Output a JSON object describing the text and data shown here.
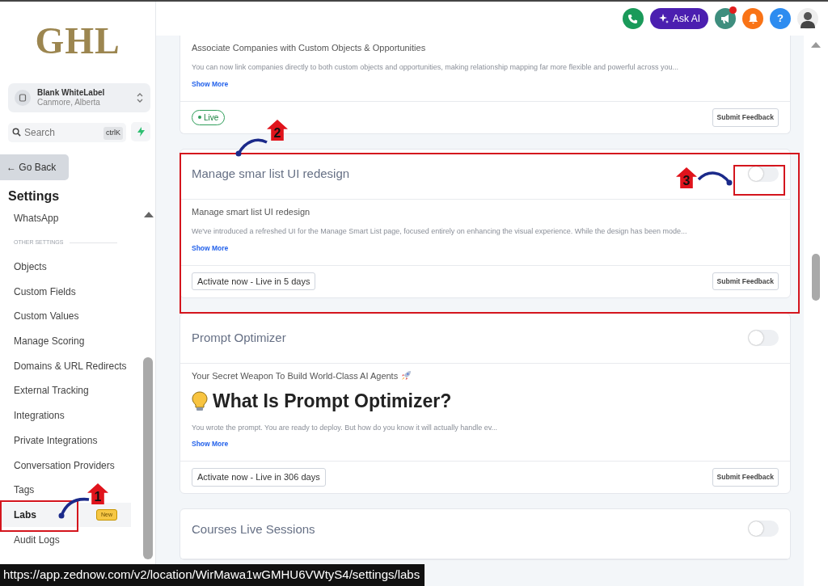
{
  "sidebar": {
    "logo": "GHL",
    "account": {
      "name": "Blank WhiteLabel",
      "location": "Canmore, Alberta"
    },
    "search": {
      "placeholder": "Search",
      "shortcut": "ctrlK"
    },
    "back_button": "← Go Back",
    "heading": "Settings",
    "items": [
      {
        "kind": "item",
        "label": "WhatsApp",
        "selected": false
      },
      {
        "kind": "section",
        "label": "OTHER SETTINGS"
      },
      {
        "kind": "item",
        "label": "Objects",
        "selected": false
      },
      {
        "kind": "item",
        "label": "Custom Fields",
        "selected": false
      },
      {
        "kind": "item",
        "label": "Custom Values",
        "selected": false
      },
      {
        "kind": "item",
        "label": "Manage Scoring",
        "selected": false
      },
      {
        "kind": "item",
        "label": "Domains & URL Redirects",
        "selected": false
      },
      {
        "kind": "item",
        "label": "External Tracking",
        "selected": false
      },
      {
        "kind": "item",
        "label": "Integrations",
        "selected": false
      },
      {
        "kind": "item",
        "label": "Private Integrations",
        "selected": false
      },
      {
        "kind": "item",
        "label": "Conversation Providers",
        "selected": false
      },
      {
        "kind": "item",
        "label": "Tags",
        "selected": false
      },
      {
        "kind": "item",
        "label": "Labs",
        "selected": true,
        "badge": "New"
      },
      {
        "kind": "item",
        "label": "Audit Logs",
        "selected": false
      }
    ]
  },
  "topbar": {
    "ask_ai": "Ask AI",
    "help": "?",
    "notification_dot": true
  },
  "cards": [
    {
      "subtitle": "Associate Companies with Custom Objects & Opportunities",
      "description": "You can now link companies directly to both custom objects and opportunities, making relationship mapping far more flexible and powerful across you...",
      "show_more": "Show More",
      "status": {
        "kind": "live",
        "label": "Live"
      },
      "feedback": "Submit Feedback"
    },
    {
      "title": "Manage smar list UI redesign",
      "on": false,
      "subtitle": "Manage smart list UI redesign",
      "description": "We've introduced a refreshed UI for the Manage Smart List page, focused entirely on enhancing the visual experience. While the design has been mode...",
      "show_more": "Show More",
      "status": {
        "kind": "activate",
        "label": "Activate now - Live in 5 days"
      },
      "feedback": "Submit Feedback"
    },
    {
      "title": "Prompt Optimizer",
      "on": false,
      "subtitle": "Your Secret Weapon To Build World-Class AI Agents",
      "headline": "What Is Prompt Optimizer?",
      "description": "You wrote the prompt. You are ready to deploy. But how do you know it will actually handle ev...",
      "show_more": "Show More",
      "status": {
        "kind": "activate",
        "label": "Activate now - Live in 306 days"
      },
      "feedback": "Submit Feedback"
    },
    {
      "title": "Courses Live Sessions",
      "on": false
    }
  ],
  "annotations": [
    {
      "number": "1"
    },
    {
      "number": "2"
    },
    {
      "number": "3"
    }
  ],
  "status_url": "https://app.zednow.com/v2/location/WirMawa1wGMHU6VWtyS4/settings/labs"
}
